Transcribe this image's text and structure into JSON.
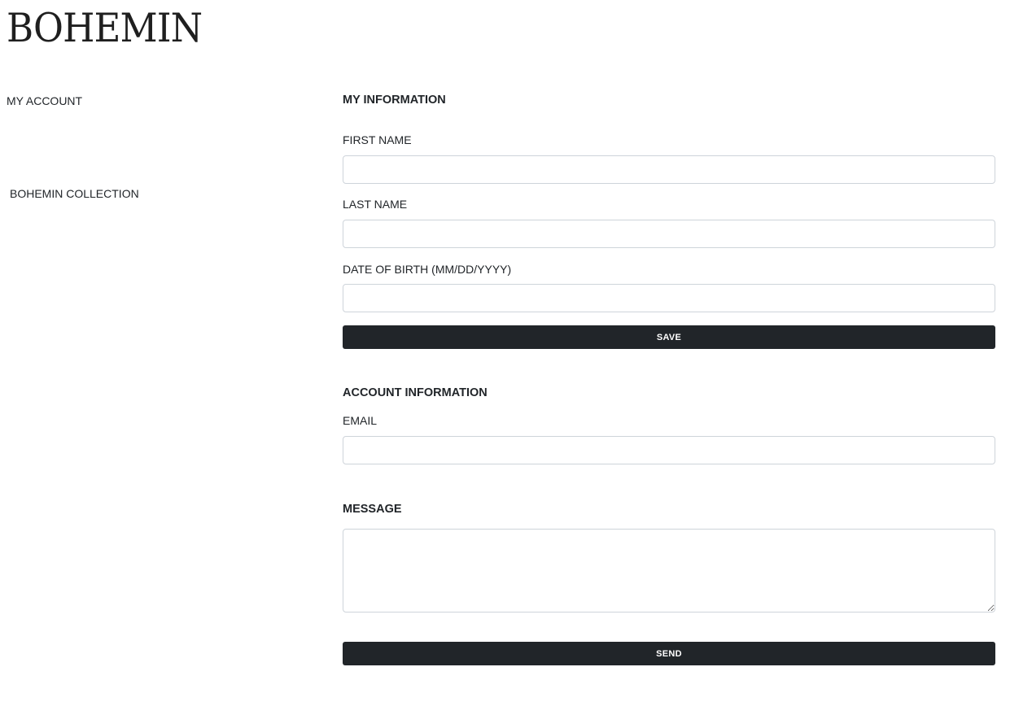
{
  "brand": {
    "name": "BOHEMIN"
  },
  "sidebar": {
    "items": [
      {
        "label": "MY ACCOUNT"
      },
      {
        "label": "BOHEMIN COLLECTION"
      }
    ]
  },
  "my_information": {
    "title": "MY INFORMATION",
    "first_name": {
      "label": "FIRST NAME",
      "value": "",
      "placeholder": ""
    },
    "last_name": {
      "label": "LAST NAME",
      "value": "",
      "placeholder": ""
    },
    "date_of_birth": {
      "label": "DATE OF BIRTH (MM/DD/YYYY)",
      "value": "",
      "placeholder": ""
    },
    "save_label": "SAVE"
  },
  "account_information": {
    "title": "ACCOUNT INFORMATION",
    "email": {
      "label": "EMAIL",
      "value": "",
      "placeholder": ""
    }
  },
  "message": {
    "title": "MESSAGE",
    "value": "",
    "placeholder": "",
    "send_label": "SEND"
  },
  "colors": {
    "button_background": "#212529",
    "button_text": "#ffffff",
    "input_border": "#ced4da",
    "text": "#212529"
  }
}
